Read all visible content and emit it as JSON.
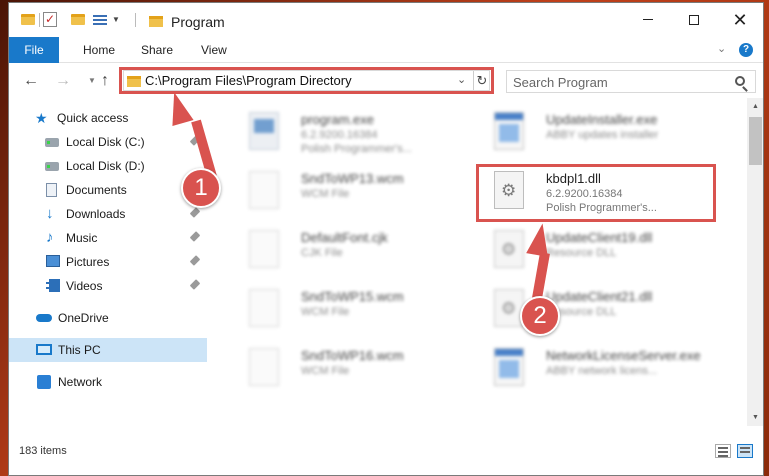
{
  "window": {
    "title": "Program"
  },
  "ribbon": {
    "tabs": [
      "File",
      "Home",
      "Share",
      "View"
    ]
  },
  "address": {
    "path": "C:\\Program Files\\Program Directory"
  },
  "search": {
    "placeholder": "Search Program"
  },
  "sidebar": {
    "items": [
      {
        "label": "Quick access",
        "icon": "star-icon",
        "pinned": false
      },
      {
        "label": "Local Disk (C:)",
        "icon": "drive-icon",
        "pinned": true
      },
      {
        "label": "Local Disk (D:)",
        "icon": "drive-icon",
        "pinned": false
      },
      {
        "label": "Documents",
        "icon": "documents-icon",
        "pinned": true
      },
      {
        "label": "Downloads",
        "icon": "download-icon",
        "pinned": true
      },
      {
        "label": "Music",
        "icon": "music-icon",
        "pinned": true
      },
      {
        "label": "Pictures",
        "icon": "pictures-icon",
        "pinned": true
      },
      {
        "label": "Videos",
        "icon": "videos-icon",
        "pinned": true
      },
      {
        "label": "OneDrive",
        "icon": "cloud-icon",
        "pinned": false
      },
      {
        "label": "This PC",
        "icon": "computer-icon",
        "pinned": false,
        "selected": true
      },
      {
        "label": "Network",
        "icon": "network-icon",
        "pinned": false
      }
    ]
  },
  "files": {
    "left": [
      {
        "name": "program.exe",
        "line2": "6.2.9200.16384",
        "line3": "Polish Programmer's...",
        "icon": "exe-icon"
      },
      {
        "name": "SndToWP13.wcm",
        "line2": "WCM File",
        "line3": "",
        "icon": "document-icon"
      },
      {
        "name": "DefaultFont.cjk",
        "line2": "CJK File",
        "line3": "",
        "icon": "document-icon"
      },
      {
        "name": "SndToWP15.wcm",
        "line2": "WCM File",
        "line3": "",
        "icon": "document-icon"
      },
      {
        "name": "SndToWP16.wcm",
        "line2": "WCM File",
        "line3": "",
        "icon": "document-icon"
      }
    ],
    "right": [
      {
        "name": "UpdateInstaller.exe",
        "line2": "ABBY updates installer",
        "line3": "",
        "icon": "application-icon"
      },
      {
        "name": "kbdpl1.dll",
        "line2": "6.2.9200.16384",
        "line3": "Polish Programmer's...",
        "icon": "dll-gear-icon",
        "highlighted": true
      },
      {
        "name": "UpdateClient19.dll",
        "line2": "Resource DLL",
        "line3": "",
        "icon": "dll-gear-icon"
      },
      {
        "name": "UpdateClient21.dll",
        "line2": "Resource DLL",
        "line3": "",
        "icon": "dll-gear-icon"
      },
      {
        "name": "NetworkLicenseServer.exe",
        "line2": "ABBY network licens...",
        "line3": "",
        "icon": "application-icon"
      }
    ]
  },
  "status": {
    "item_count": "183 items"
  },
  "callouts": {
    "step1": "1",
    "step2": "2"
  },
  "colors": {
    "accent": "#1979ca",
    "highlight": "#d9534f",
    "selection": "#cce4f7"
  }
}
